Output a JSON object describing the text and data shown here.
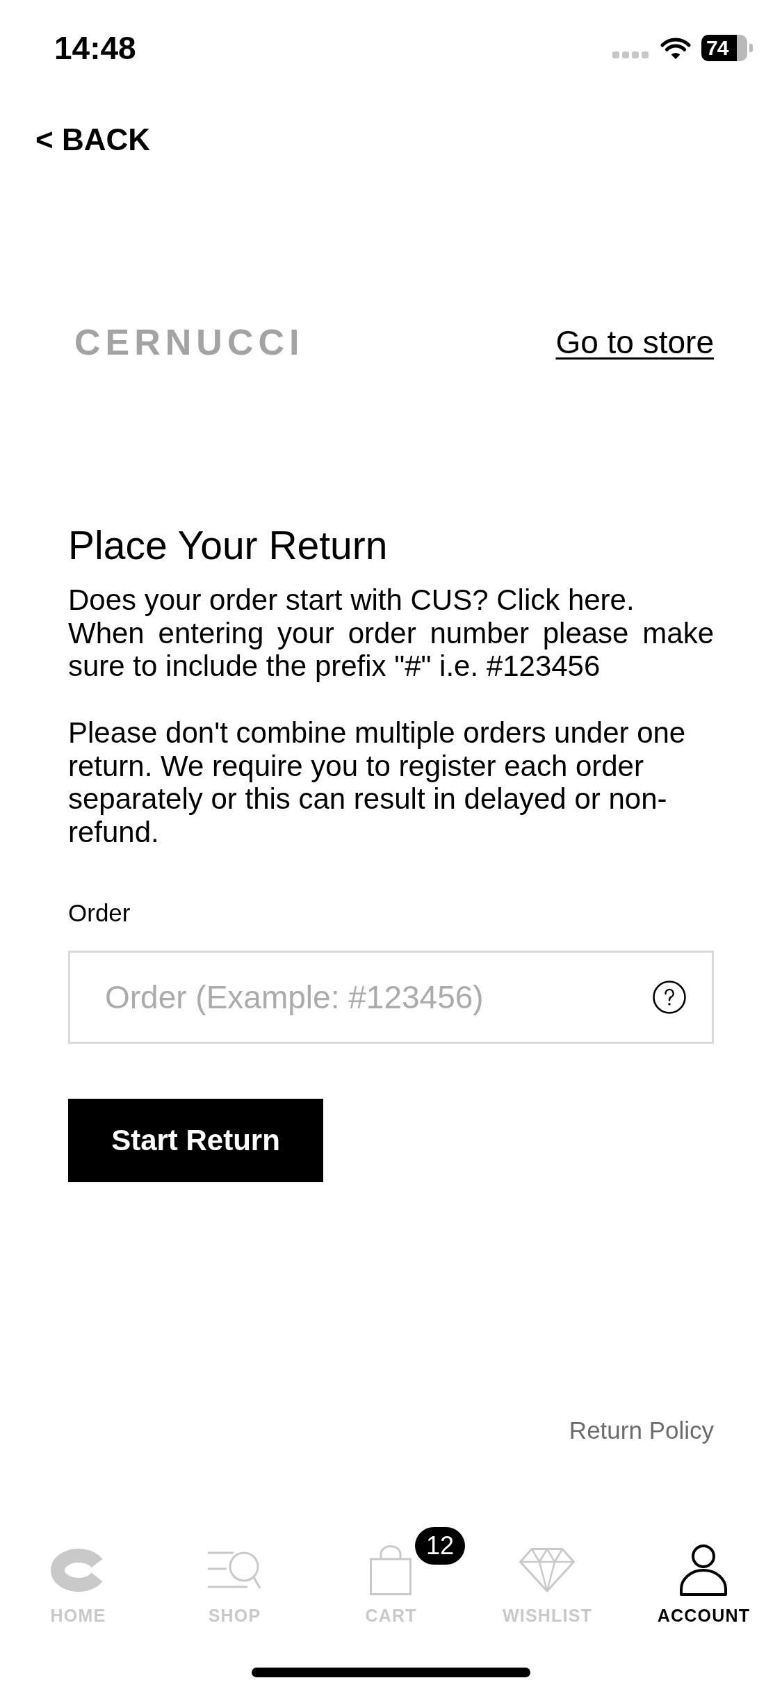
{
  "status_bar": {
    "time": "14:48",
    "battery": "74"
  },
  "back_button": "< BACK",
  "header": {
    "logo": "CERNUCCI",
    "store_link": "Go to store"
  },
  "return_form": {
    "title": "Place Your Return",
    "intro": [
      "Does your order start with CUS? Click here.",
      "When entering your order number please make sure to include the prefix \"#\" i.e. #123456"
    ],
    "notice": "Please don't combine multiple orders under one return. We require you to register each order separately or this can result in delayed or non-refund.",
    "order_field": {
      "label": "Order",
      "placeholder": "Order (Example: #123456)"
    },
    "submit_button": "Start Return"
  },
  "return_policy_link": "Return Policy",
  "tabs": [
    {
      "label": "HOME",
      "selected": false
    },
    {
      "label": "SHOP",
      "selected": false
    },
    {
      "label": "CART",
      "selected": false,
      "badge": "12"
    },
    {
      "label": "WISHLIST",
      "selected": false
    },
    {
      "label": "ACCOUNT",
      "selected": true
    }
  ]
}
